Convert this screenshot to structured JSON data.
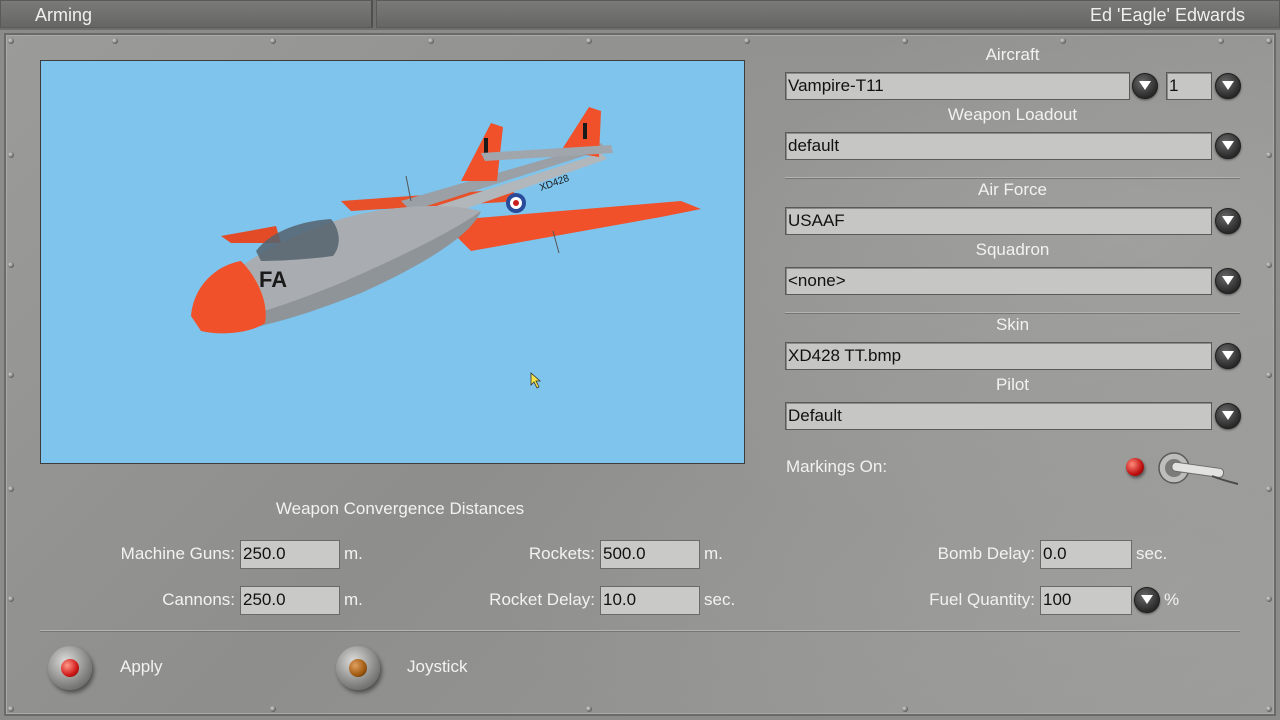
{
  "topbar": {
    "screen_title": "Arming",
    "player_name": "Ed 'Eagle' Edwards"
  },
  "aircraft": {
    "label": "Aircraft",
    "value": "Vampire-T11",
    "count": "1"
  },
  "weapon_loadout": {
    "label": "Weapon Loadout",
    "value": "default"
  },
  "air_force": {
    "label": "Air Force",
    "value": "USAAF"
  },
  "squadron": {
    "label": "Squadron",
    "value": "<none>"
  },
  "skin": {
    "label": "Skin",
    "value": "XD428 TT.bmp"
  },
  "pilot": {
    "label": "Pilot",
    "value": "Default"
  },
  "markings": {
    "label": "Markings On:",
    "on": true
  },
  "preview": {
    "tail_number": "XD428",
    "nose_code": "FA"
  },
  "convergence": {
    "title": "Weapon Convergence Distances",
    "machine_guns": {
      "label": "Machine Guns:",
      "value": "250.0",
      "unit": "m."
    },
    "cannons": {
      "label": "Cannons:",
      "value": "250.0",
      "unit": "m."
    },
    "rockets": {
      "label": "Rockets:",
      "value": "500.0",
      "unit": "m."
    },
    "rocket_delay": {
      "label": "Rocket Delay:",
      "value": "10.0",
      "unit": "sec."
    },
    "bomb_delay": {
      "label": "Bomb Delay:",
      "value": "0.0",
      "unit": "sec."
    },
    "fuel_quantity": {
      "label": "Fuel Quantity:",
      "value": "100",
      "unit": "%"
    }
  },
  "buttons": {
    "apply": "Apply",
    "joystick": "Joystick"
  },
  "colors": {
    "sky": "#7ec4ec",
    "fuselage": "#a9adb1",
    "trainer_orange": "#f0512a",
    "lamp_red": "#d01818",
    "lamp_amber": "#a05a10"
  },
  "icons": [
    "chevron-down-icon",
    "toggle-switch-icon",
    "mouse-cursor-icon",
    "rivet-icon"
  ]
}
